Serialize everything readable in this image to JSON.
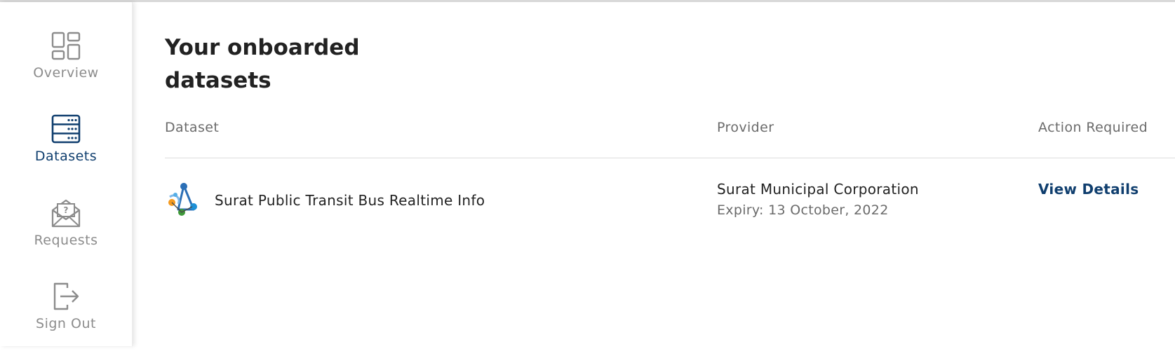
{
  "sidebar": {
    "items": [
      {
        "label": "Overview",
        "icon": "overview-grid-icon",
        "active": false
      },
      {
        "label": "Datasets",
        "icon": "server-rack-icon",
        "active": true
      },
      {
        "label": "Requests",
        "icon": "envelope-question-icon",
        "active": false
      },
      {
        "label": "Sign Out",
        "icon": "sign-out-icon",
        "active": false
      }
    ]
  },
  "main": {
    "title": "Your onboarded datasets",
    "columns": {
      "dataset": "Dataset",
      "provider": "Provider",
      "action": "Action Required"
    },
    "rows": [
      {
        "logo_icon": "dataset-logo-icon",
        "dataset": "Surat Public Transit Bus Realtime Info",
        "provider": "Surat Municipal Corporation",
        "expiry": "Expiry: 13 October, 2022",
        "action": "View Details"
      }
    ]
  },
  "colors": {
    "active_nav": "#0f3e6e",
    "inactive_nav": "#8c8c8c",
    "link": "#0f3e6e",
    "text": "#222222",
    "muted_text": "#6b6b6b"
  }
}
